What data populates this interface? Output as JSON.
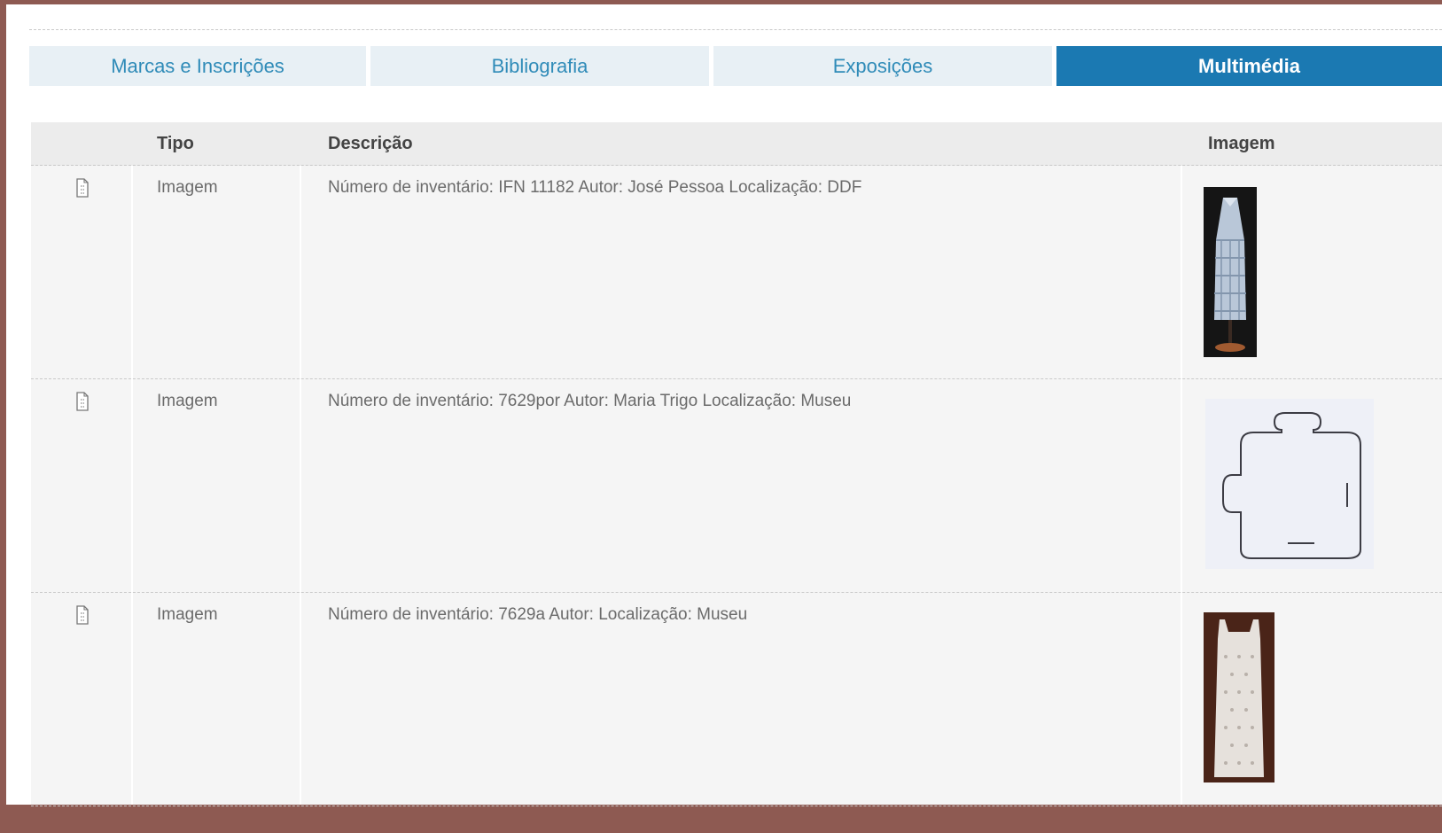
{
  "tabs": [
    {
      "label": "Marcas e Inscrições",
      "active": false
    },
    {
      "label": "Bibliografia",
      "active": false
    },
    {
      "label": "Exposições",
      "active": false
    },
    {
      "label": "Multimédia",
      "active": true
    }
  ],
  "table": {
    "headers": {
      "icon": "",
      "tipo": "Tipo",
      "descricao": "Descrição",
      "imagem": "Imagem"
    },
    "rows": [
      {
        "icon": "document-icon",
        "tipo": "Imagem",
        "descricao": "Número de inventário: IFN 11182 Autor: José Pessoa Localização: DDF",
        "imagem": "dress-on-mannequin-thumbnail"
      },
      {
        "icon": "document-icon",
        "tipo": "Imagem",
        "descricao": "Número de inventário: 7629por Autor: Maria Trigo Localização: Museu",
        "imagem": "garment-pattern-drawing-thumbnail"
      },
      {
        "icon": "document-icon",
        "tipo": "Imagem",
        "descricao": "Número de inventário: 7629a Autor: Localização: Museu",
        "imagem": "white-lace-dress-thumbnail"
      }
    ]
  },
  "colors": {
    "frame": "#8e5a52",
    "tab_inactive_bg": "#e8f0f5",
    "tab_inactive_text": "#2f8bb8",
    "tab_active_bg": "#1b79b2",
    "tab_active_text": "#ffffff",
    "table_bg": "#f5f5f5",
    "header_bg": "#ececec"
  }
}
